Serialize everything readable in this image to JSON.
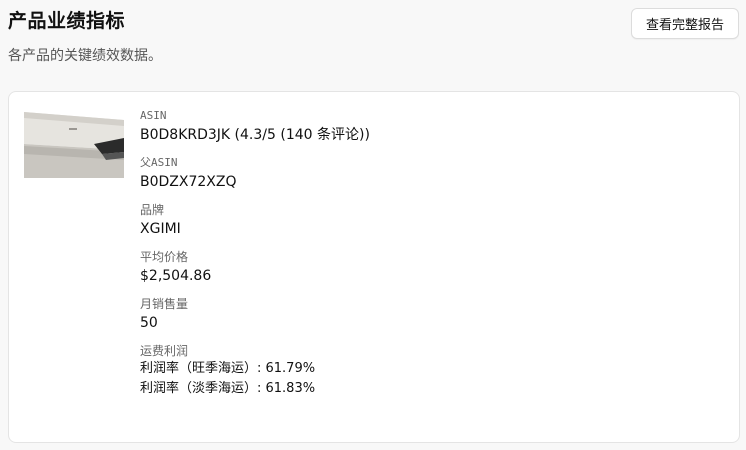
{
  "header": {
    "title": "产品业绩指标",
    "subtitle": "各产品的关键绩效数据。",
    "report_button": "查看完整报告"
  },
  "product": {
    "asin_label": "ASIN",
    "asin_value": "B0D8KRD3JK (4.3/5 (140 条评论))",
    "parent_asin_label": "父ASIN",
    "parent_asin_value": "B0DZX72XZQ",
    "brand_label": "品牌",
    "brand_value": "XGIMI",
    "avg_price_label": "平均价格",
    "avg_price_value": "$2,504.86",
    "monthly_sales_label": "月销售量",
    "monthly_sales_value": "50",
    "shipping_profit_label": "运费利润",
    "profit_peak": "利润率（旺季海运）: 61.79%",
    "profit_off": "利润率（淡季海运）: 61.83%"
  }
}
